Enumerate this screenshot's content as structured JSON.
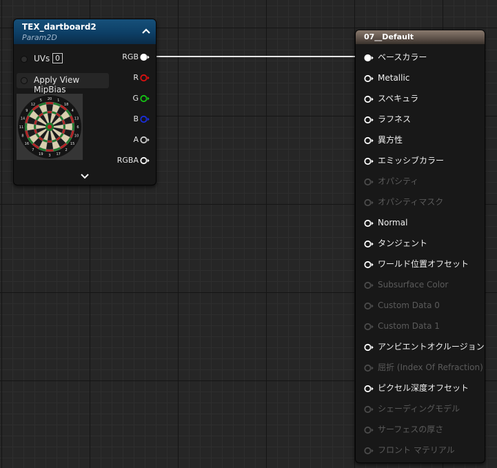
{
  "texture_node": {
    "title": "TEX_dartboard2",
    "subtitle": "Param2D",
    "uv_label": "UVs",
    "uv_value": "0",
    "mip_label": "Apply View MipBias",
    "outputs": [
      {
        "label": "RGB",
        "color": "#ffffff",
        "connected": true
      },
      {
        "label": "R",
        "color": "#e01010",
        "connected": false
      },
      {
        "label": "G",
        "color": "#14c814",
        "connected": false
      },
      {
        "label": "B",
        "color": "#1a2ee0",
        "connected": false
      },
      {
        "label": "A",
        "color": "#d0d0d0",
        "connected": false
      },
      {
        "label": "RGBA",
        "color": "#ffffff",
        "connected": false
      }
    ]
  },
  "material_node": {
    "title": "07__Default",
    "inputs": [
      {
        "label": "ベースカラー",
        "enabled": true,
        "connected": true
      },
      {
        "label": "Metallic",
        "enabled": true,
        "connected": false
      },
      {
        "label": "スペキュラ",
        "enabled": true,
        "connected": false
      },
      {
        "label": "ラフネス",
        "enabled": true,
        "connected": false
      },
      {
        "label": "異方性",
        "enabled": true,
        "connected": false
      },
      {
        "label": "エミッシブカラー",
        "enabled": true,
        "connected": false
      },
      {
        "label": "オパシティ",
        "enabled": false,
        "connected": false
      },
      {
        "label": "オパシティマスク",
        "enabled": false,
        "connected": false
      },
      {
        "label": "Normal",
        "enabled": true,
        "connected": false
      },
      {
        "label": "タンジェント",
        "enabled": true,
        "connected": false
      },
      {
        "label": "ワールド位置オフセット",
        "enabled": true,
        "connected": false
      },
      {
        "label": "Subsurface Color",
        "enabled": false,
        "connected": false
      },
      {
        "label": "Custom Data 0",
        "enabled": false,
        "connected": false
      },
      {
        "label": "Custom Data 1",
        "enabled": false,
        "connected": false
      },
      {
        "label": "アンビエントオクルージョン",
        "enabled": true,
        "connected": false
      },
      {
        "label": "屈折 (Index Of Refraction)",
        "enabled": false,
        "connected": false
      },
      {
        "label": "ピクセル深度オフセット",
        "enabled": true,
        "connected": false
      },
      {
        "label": "シェーディングモデル",
        "enabled": false,
        "connected": false
      },
      {
        "label": "サーフェスの厚さ",
        "enabled": false,
        "connected": false
      },
      {
        "label": "フロント マテリアル",
        "enabled": false,
        "connected": false
      }
    ]
  },
  "dartboard_numbers": [
    "20",
    "1",
    "18",
    "4",
    "13",
    "6",
    "10",
    "15",
    "2",
    "17",
    "3",
    "19",
    "7",
    "16",
    "8",
    "11",
    "14",
    "9",
    "12",
    "5"
  ]
}
